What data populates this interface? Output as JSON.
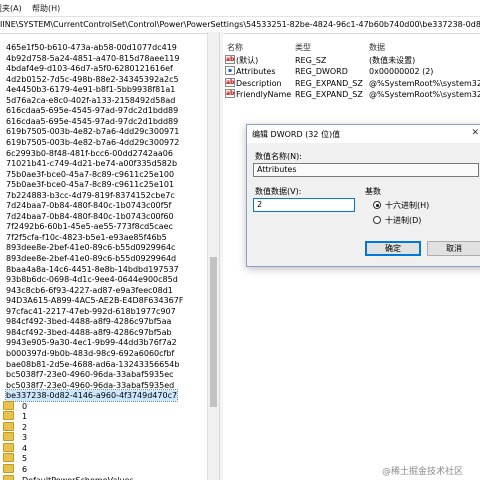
{
  "menubar": {
    "item1": "收藏夹(A)",
    "item2": "帮助(H)"
  },
  "address": "IINE\\SYSTEM\\CurrentControlSet\\Control\\Power\\PowerSettings\\54533251-82be-4824-96c1-47b60b740d00\\be337238-0d82-4146-a960-4f",
  "tree": {
    "items": [
      "465e1f50-b610-473a-ab58-00d1077dc419",
      "4b92d758-5a24-4851-a470-815d78aee119",
      "4bdaf4e9-d103-46d7-a5f0-6280121616ef",
      "4d2b0152-7d5c-498b-88e2-34345392a2c5",
      "4e4450b3-6179-4e91-b8f1-5bb9938f81a1",
      "5d76a2ca-e8c0-402f-a133-2158492d58ad",
      "616cdaa5-695e-4545-97ad-97dc2d1bdd89",
      "616cdaa5-695e-4545-97ad-97dc2d1bdd89",
      "619b7505-003b-4e82-b7a6-4dd29c300971",
      "619b7505-003b-4e82-b7a6-4dd29c300972",
      "6c2993b0-8f48-481f-bcc6-00dd2742aa06",
      "71021b41-c749-4d21-be74-a00f335d582b",
      "75b0ae3f-bce0-45a7-8c89-c9611c25e100",
      "75b0ae3f-bce0-45a7-8c89-c9611c25e101",
      "7b224883-b3cc-4d79-819f-8374152cbe7c",
      "7d24baa7-0b84-480f-840c-1b0743c00f5f",
      "7d24baa7-0b84-480f-840c-1b0743c00f60",
      "7f2492b6-60b1-45e5-ae55-773f8cd5caec",
      "7f2f5cfa-f10c-4823-b5e1-e93ae85f46b5",
      "893dee8e-2bef-41e0-89c6-b55d0929964c",
      "893dee8e-2bef-41e0-89c6-b55d0929964d",
      "8baa4a8a-14c6-4451-8e8b-14bdbd197537",
      "93b8b6dc-0698-4d1c-9ee4-0644e900c85d",
      "943c8cb6-6f93-4227-ad87-e9a3feec08d1",
      "94D3A615-A899-4AC5-AE2B-E4D8F634367F",
      "97cfac41-2217-47eb-992d-618b1977c907",
      "984cf492-3bed-4488-a8f9-4286c97bf5aa",
      "984cf492-3bed-4488-a8f9-4286c97bf5ab",
      "9943e905-9a30-4ec1-9b99-44dd3b76f7a2",
      "b000397d-9b0b-483d-98c9-692a6060cfbf",
      "bae08b81-2d5e-4688-ad6a-13243356654b",
      "bc5038f7-23e0-4960-96da-33abaf5935ec",
      "bc5038f7-23e0-4960-96da-33abaf5935ed",
      "be337238-0d82-4146-a960-4f3749d470c7"
    ],
    "subfolders": [
      "0",
      "1",
      "2",
      "3",
      "4",
      "5",
      "6",
      "DefaultPowerSchemeValues"
    ]
  },
  "list": {
    "headers": {
      "name": "名称",
      "type": "类型",
      "data": "数据"
    },
    "rows": [
      {
        "name": "(默认)",
        "type": "REG_SZ",
        "data": "(数值未设置)",
        "icon": "ab"
      },
      {
        "name": "Attributes",
        "type": "REG_DWORD",
        "data": "0x00000002 (2)",
        "icon": "bin"
      },
      {
        "name": "Description",
        "type": "REG_EXPAND_SZ",
        "data": "@%SystemRoot%\\system32\\pow",
        "icon": "ab"
      },
      {
        "name": "FriendlyName",
        "type": "REG_EXPAND_SZ",
        "data": "@%SystemRoot%\\system32\\pov",
        "icon": "ab"
      }
    ]
  },
  "dialog": {
    "title": "编辑 DWORD (32 位)值",
    "close": "✕",
    "name_label": "数值名称(N):",
    "name_value": "Attributes",
    "data_label": "数值数据(V):",
    "data_value": "2",
    "base_label": "基数",
    "hex_label": "十六进制(H)",
    "dec_label": "十进制(D)",
    "base_selected": "hex",
    "ok": "确定",
    "cancel": "取消"
  },
  "watermark": "@稀土掘金技术社区"
}
